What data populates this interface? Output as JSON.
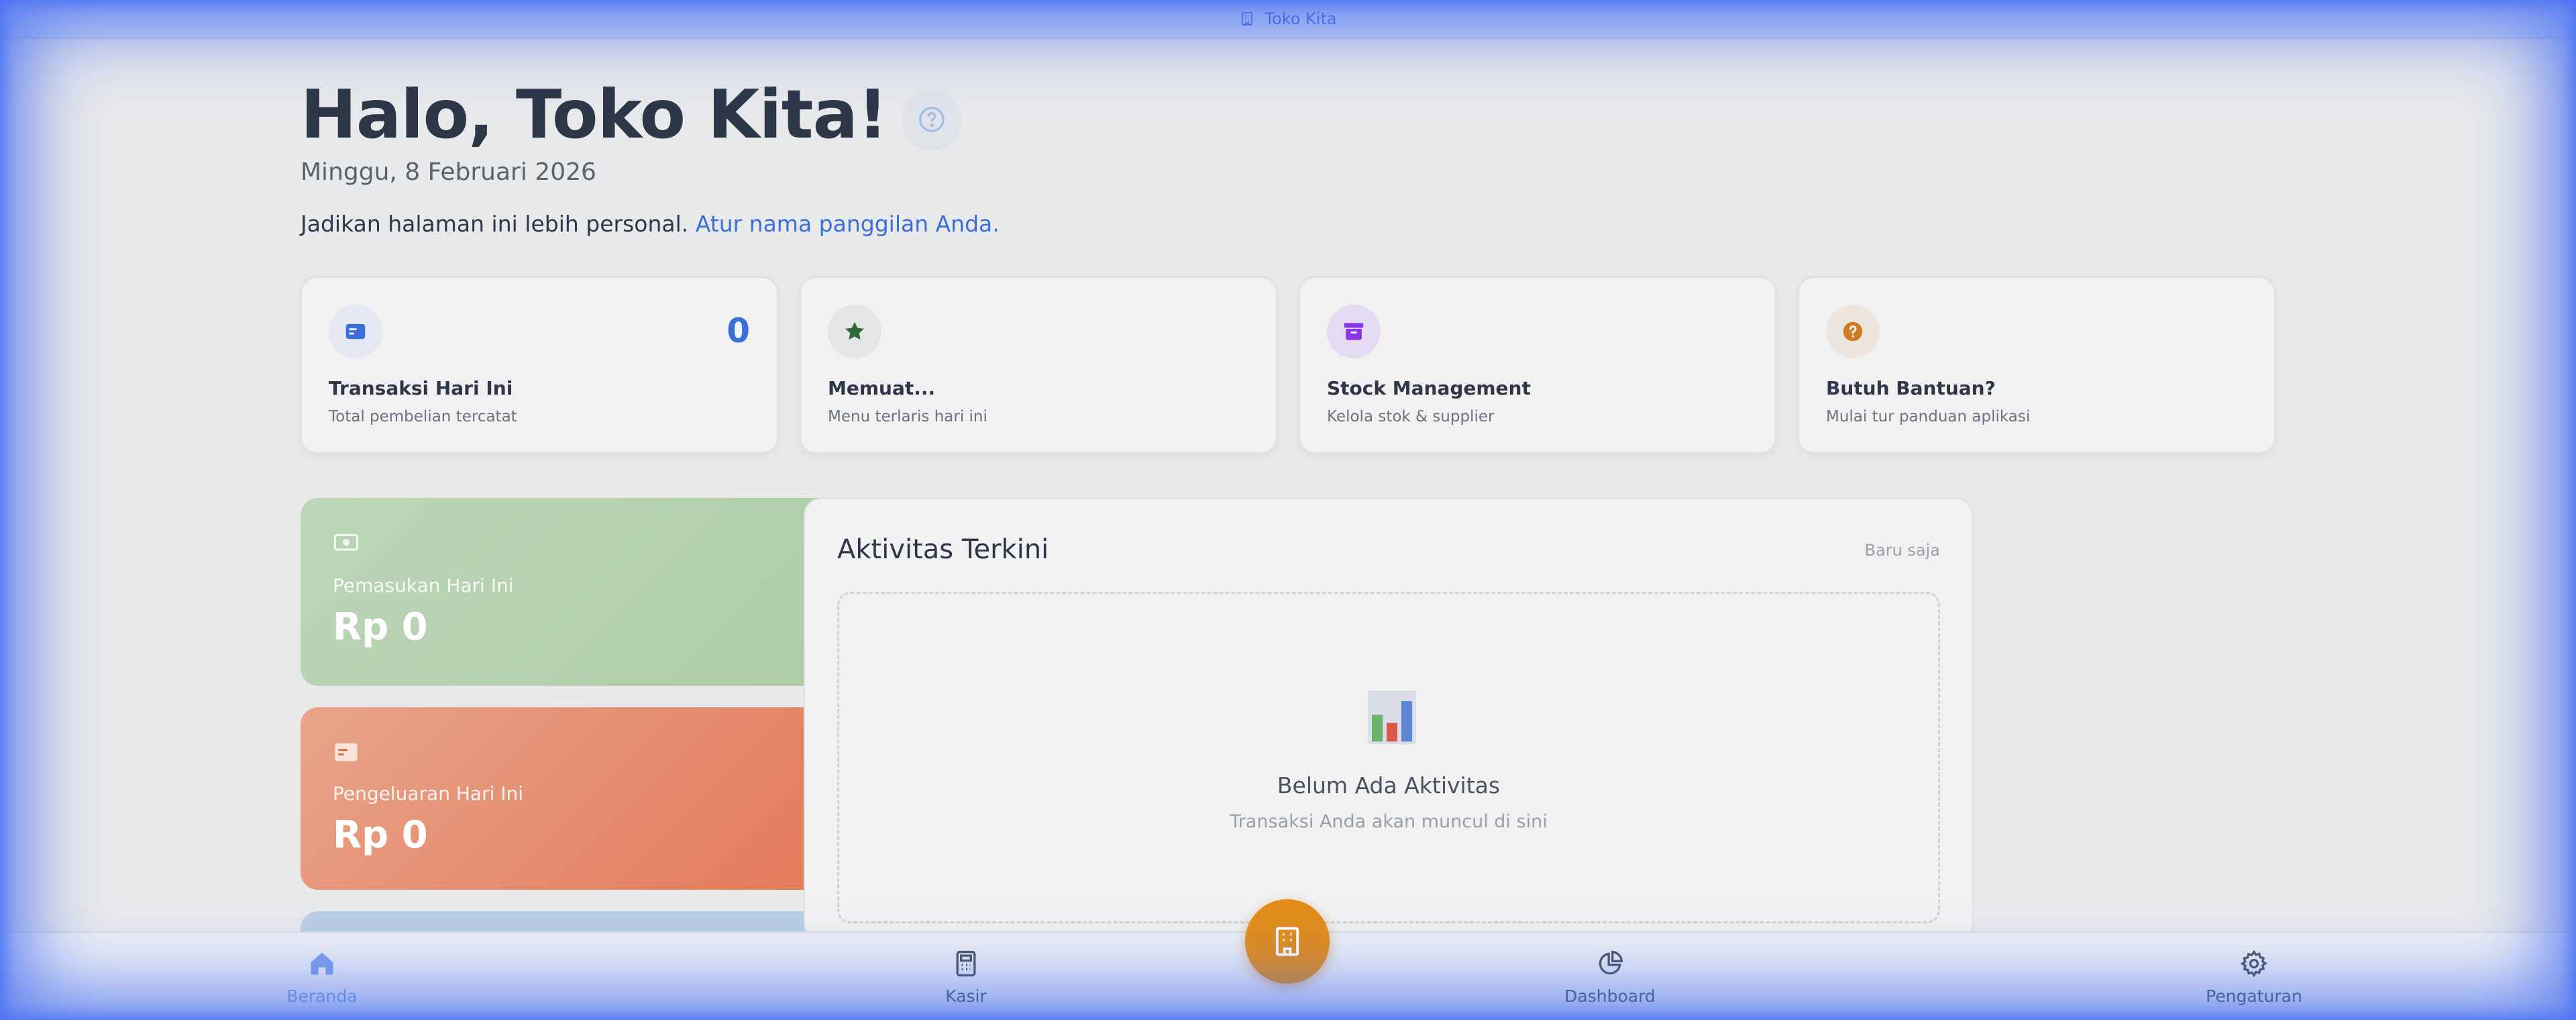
{
  "topbar": {
    "title": "Toko Kita",
    "icon": "building-icon"
  },
  "header": {
    "greeting": "Halo, Toko Kita!",
    "date": "Minggu, 8 Februari 2026",
    "personal_text": "Jadikan halaman ini lebih personal.",
    "personal_link": "Atur nama panggilan Anda."
  },
  "stats": [
    {
      "icon": "credit-card-icon",
      "count": "0",
      "title": "Transaksi Hari Ini",
      "subtitle": "Total pembelian tercatat",
      "color": "#3a6fd8"
    },
    {
      "icon": "star-icon",
      "title": "Memuat...",
      "subtitle": "Menu terlaris hari ini",
      "color": "#2f6a3a"
    },
    {
      "icon": "archive-box-icon",
      "title": "Stock Management",
      "subtitle": "Kelola stok & supplier",
      "color": "#8b35e8"
    },
    {
      "icon": "question-icon",
      "title": "Butuh Bantuan?",
      "subtitle": "Mulai tur panduan aplikasi",
      "color": "#d07a22"
    }
  ],
  "finance": {
    "income": {
      "label": "Pemasukan Hari Ini",
      "value": "Rp 0",
      "icon": "cash-icon"
    },
    "expense": {
      "label": "Pengeluaran Hari Ini",
      "value": "Rp 0",
      "icon": "card-icon"
    }
  },
  "activity": {
    "title": "Aktivitas Terkini",
    "time": "Baru saja",
    "empty_title": "Belum Ada Aktivitas",
    "empty_subtitle": "Transaksi Anda akan muncul di sini"
  },
  "nav": [
    {
      "label": "Beranda",
      "icon": "home-icon",
      "active": true
    },
    {
      "label": "Kasir",
      "icon": "calculator-icon"
    },
    {
      "label": "Dashboard",
      "icon": "pie-chart-icon"
    },
    {
      "label": "Pengaturan",
      "icon": "gear-icon"
    }
  ],
  "fab": {
    "icon": "building-icon",
    "color": "#e28d1a"
  },
  "colors": {
    "accent": "#3a6fd8",
    "income": "#a9cba0",
    "expense": "#e6704e"
  }
}
